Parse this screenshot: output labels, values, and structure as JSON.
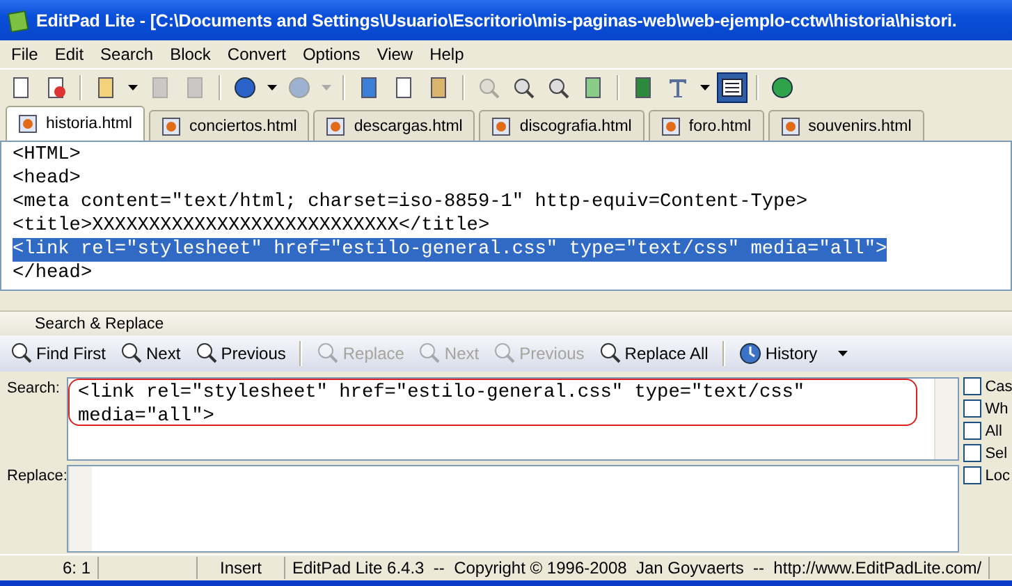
{
  "window": {
    "title": "EditPad Lite - [C:\\Documents and Settings\\Usuario\\Escritorio\\mis-paginas-web\\web-ejemplo-cctw\\historia\\histori."
  },
  "menu": [
    "File",
    "Edit",
    "Search",
    "Block",
    "Convert",
    "Options",
    "View",
    "Help"
  ],
  "toolbar": [
    {
      "kind": "new",
      "disabled": false
    },
    {
      "kind": "close",
      "disabled": false
    },
    {
      "kind": "sep"
    },
    {
      "kind": "open",
      "disabled": false
    },
    {
      "kind": "drop",
      "disabled": false
    },
    {
      "kind": "save",
      "disabled": true
    },
    {
      "kind": "saveall",
      "disabled": true
    },
    {
      "kind": "sep"
    },
    {
      "kind": "undo",
      "disabled": false
    },
    {
      "kind": "drop",
      "disabled": false
    },
    {
      "kind": "redo",
      "disabled": true
    },
    {
      "kind": "drop",
      "disabled": true
    },
    {
      "kind": "sep"
    },
    {
      "kind": "cut",
      "disabled": false
    },
    {
      "kind": "copy",
      "disabled": false
    },
    {
      "kind": "paste",
      "disabled": false
    },
    {
      "kind": "sep"
    },
    {
      "kind": "search",
      "disabled": true
    },
    {
      "kind": "findnext",
      "disabled": false
    },
    {
      "kind": "findprev",
      "disabled": false
    },
    {
      "kind": "replace",
      "disabled": false
    },
    {
      "kind": "sep"
    },
    {
      "kind": "wrap",
      "disabled": false
    },
    {
      "kind": "font",
      "disabled": false
    },
    {
      "kind": "drop",
      "disabled": false
    },
    {
      "kind": "lines",
      "disabled": false,
      "selected": true
    },
    {
      "kind": "sep"
    },
    {
      "kind": "globe",
      "disabled": false
    }
  ],
  "tabs": [
    {
      "label": "historia.html",
      "selected": true
    },
    {
      "label": "conciertos.html",
      "selected": false
    },
    {
      "label": "descargas.html",
      "selected": false
    },
    {
      "label": "discografia.html",
      "selected": false
    },
    {
      "label": "foro.html",
      "selected": false
    },
    {
      "label": "souvenirs.html",
      "selected": false
    }
  ],
  "editor": {
    "lines": [
      {
        "text": "<HTML>",
        "selected": false
      },
      {
        "text": "<head>",
        "selected": false
      },
      {
        "text": "<meta content=\"text/html; charset=iso-8859-1\" http-equiv=Content-Type>",
        "selected": false
      },
      {
        "text": "<title>XXXXXXXXXXXXXXXXXXXXXXXXXXX</title>",
        "selected": false
      },
      {
        "text": "<link rel=\"stylesheet\" href=\"estilo-general.css\" type=\"text/css\" media=\"all\">",
        "selected": true
      },
      {
        "text": "</head>",
        "selected": false
      }
    ]
  },
  "search_panel": {
    "title": "Search & Replace",
    "buttons": [
      {
        "kind": "findfirst",
        "label": "Find First",
        "disabled": false
      },
      {
        "kind": "next",
        "label": "Next",
        "disabled": false
      },
      {
        "kind": "prev",
        "label": "Previous",
        "disabled": false
      },
      {
        "kind": "sep"
      },
      {
        "kind": "replace",
        "label": "Replace",
        "disabled": true
      },
      {
        "kind": "next2",
        "label": "Next",
        "disabled": true
      },
      {
        "kind": "prev2",
        "label": "Previous",
        "disabled": true
      },
      {
        "kind": "replaceall",
        "label": "Replace All",
        "disabled": false
      },
      {
        "kind": "sep"
      },
      {
        "kind": "history",
        "label": "History",
        "disabled": false
      }
    ],
    "search_label": "Search:",
    "search_value": "<link rel=\"stylesheet\" href=\"estilo-general.css\" type=\"text/css\" media=\"all\">",
    "replace_label": "Replace:",
    "options": [
      {
        "label": "Cas",
        "checked": false
      },
      {
        "label": "Wh",
        "checked": false
      },
      {
        "label": "All",
        "checked": false
      },
      {
        "label": "Sel",
        "checked": false
      },
      {
        "label": "Loc",
        "checked": false
      }
    ]
  },
  "status_bar": {
    "position": "6: 1",
    "mode": "Insert",
    "info": "EditPad Lite 6.4.3  --  Copyright © 1996-2008  Jan Goyvaerts  --  http://www.EditPadLite.com/"
  }
}
